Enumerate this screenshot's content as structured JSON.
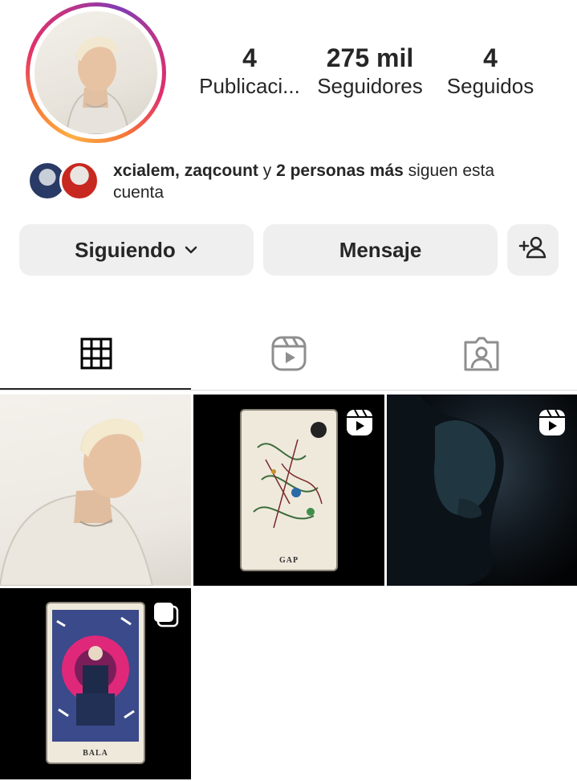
{
  "profile": {
    "stats": [
      {
        "value": "4",
        "label": "Publicaci..."
      },
      {
        "value": "275 mil",
        "label": "Seguidores"
      },
      {
        "value": "4",
        "label": "Seguidos"
      }
    ]
  },
  "followed_by": {
    "names": "xcialem, zaqcount",
    "connector": " y ",
    "more": "2 personas más",
    "suffix": " siguen esta cuenta"
  },
  "actions": {
    "following_label": "Siguiendo",
    "message_label": "Mensaje"
  },
  "tabs": [
    {
      "icon": "grid-icon",
      "active": true
    },
    {
      "icon": "reels-icon",
      "active": false
    },
    {
      "icon": "tagged-icon",
      "active": false
    }
  ],
  "posts": [
    {
      "type": "photo"
    },
    {
      "type": "reel",
      "card_label": "GAP"
    },
    {
      "type": "reel"
    },
    {
      "type": "carousel",
      "card_label": "BALA"
    }
  ],
  "colors": {
    "text": "#262626",
    "button_bg": "#efefef",
    "story_ring": "#e1306c"
  }
}
